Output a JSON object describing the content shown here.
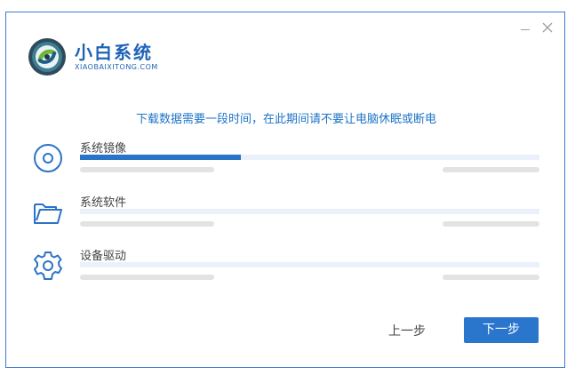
{
  "window": {
    "controls": {
      "minimize_icon": "minimize-icon",
      "close_icon": "close-icon"
    }
  },
  "brand": {
    "title": "小白系统",
    "subtitle": "XIAOBAIXITONG.COM",
    "logo_icon": "xiaobai-logo-icon",
    "color": "#1e63b8"
  },
  "notice": "下载数据需要一段时间，在此期间请不要让电脑休眠或断电",
  "items": [
    {
      "label": "系统镜像",
      "icon": "disc-icon",
      "progress": 0.35
    },
    {
      "label": "系统软件",
      "icon": "folder-icon",
      "progress": 0
    },
    {
      "label": "设备驱动",
      "icon": "gear-icon",
      "progress": 0
    }
  ],
  "buttons": {
    "prev": "上一步",
    "next": "下一步"
  },
  "colors": {
    "accent": "#2b76cd",
    "notice": "#1e74c6",
    "track": "#eaf1fb"
  }
}
